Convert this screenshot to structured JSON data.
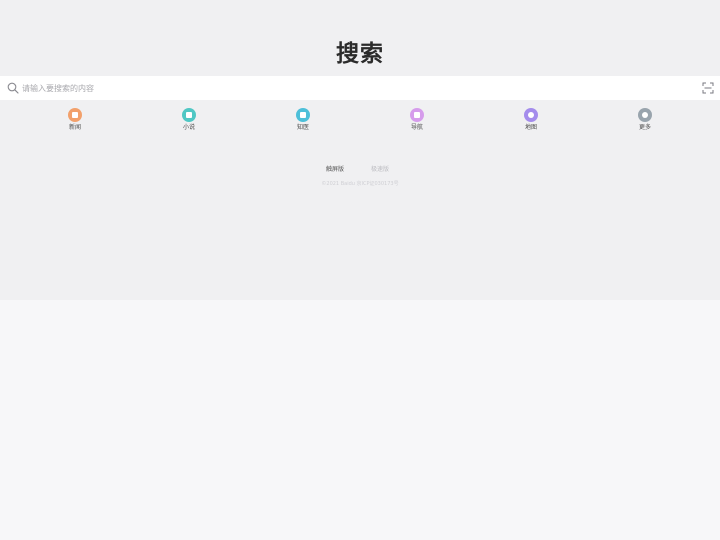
{
  "header": {
    "title": "搜索"
  },
  "search": {
    "placeholder": "请输入要搜索的内容",
    "value": "",
    "search_icon": "search-icon",
    "scan_icon": "scan-icon"
  },
  "quick_links": [
    {
      "label": "新闻",
      "icon": "news-icon",
      "color": "#f2a06b"
    },
    {
      "label": "小说",
      "icon": "novel-icon",
      "color": "#4fc7c4"
    },
    {
      "label": "知医",
      "icon": "medical-icon",
      "color": "#4dbfd9"
    },
    {
      "label": "导航",
      "icon": "navigation-icon",
      "color": "#d69cec"
    },
    {
      "label": "地图",
      "icon": "map-icon",
      "color": "#a48cec"
    },
    {
      "label": "更多",
      "icon": "more-icon",
      "color": "#99a4ad"
    }
  ],
  "footer": {
    "active_link": "触屏版",
    "muted_link": "极速版",
    "copyright": "©2021 Baidu 京ICP证030173号"
  },
  "colors": {
    "top_background": "#f0f0f2",
    "page_background": "#f7f7f9",
    "search_background": "#ffffff"
  }
}
